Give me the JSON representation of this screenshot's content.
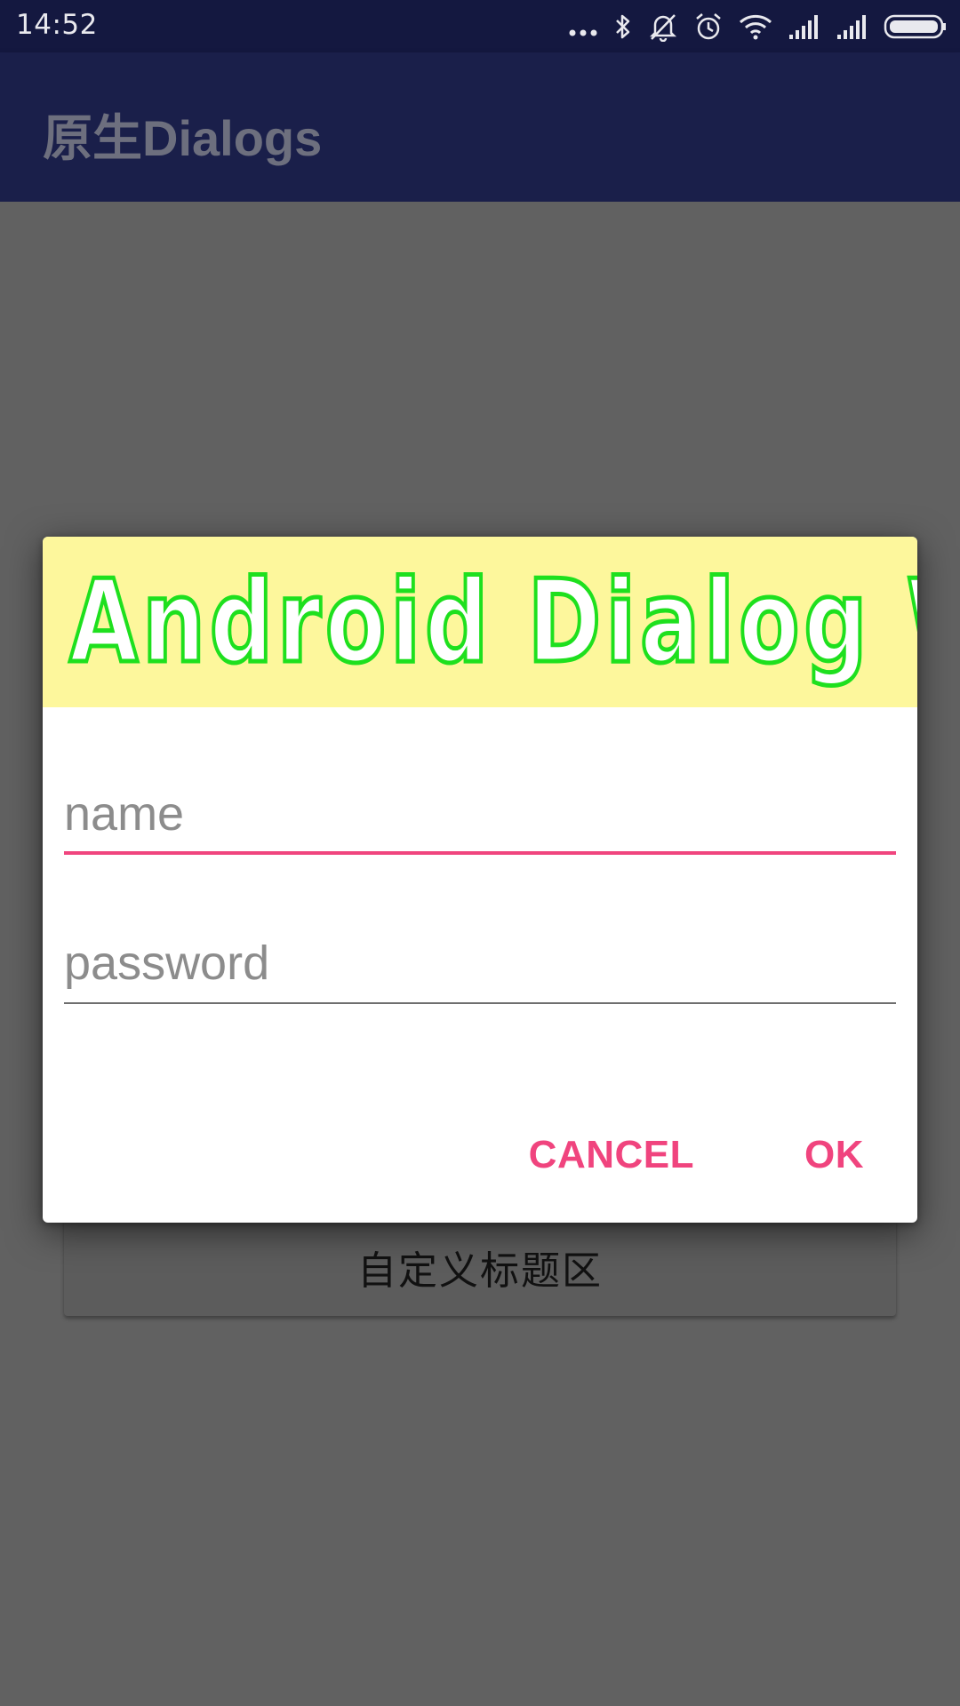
{
  "status_bar": {
    "time": "14:52",
    "icons": [
      "more-dots-icon",
      "bluetooth-icon",
      "silent-bell-icon",
      "alarm-icon",
      "wifi-icon",
      "signal-icon",
      "signal-icon",
      "battery-icon"
    ]
  },
  "app_bar": {
    "title": "原生Dialogs"
  },
  "background": {
    "button_label": "自定义标题区"
  },
  "dialog": {
    "banner_text": "Android Dialog WSJ",
    "name_field": {
      "placeholder": "name",
      "value": ""
    },
    "password_field": {
      "placeholder": "password",
      "value": ""
    },
    "cancel_label": "CANCEL",
    "ok_label": "OK"
  },
  "colors": {
    "status_bar": "#141840",
    "app_bar": "#1a1f4a",
    "scrim_content": "#616161",
    "accent": "#f0447e",
    "banner_bg": "#fdf79c",
    "banner_text_outline": "#1ee01e"
  }
}
